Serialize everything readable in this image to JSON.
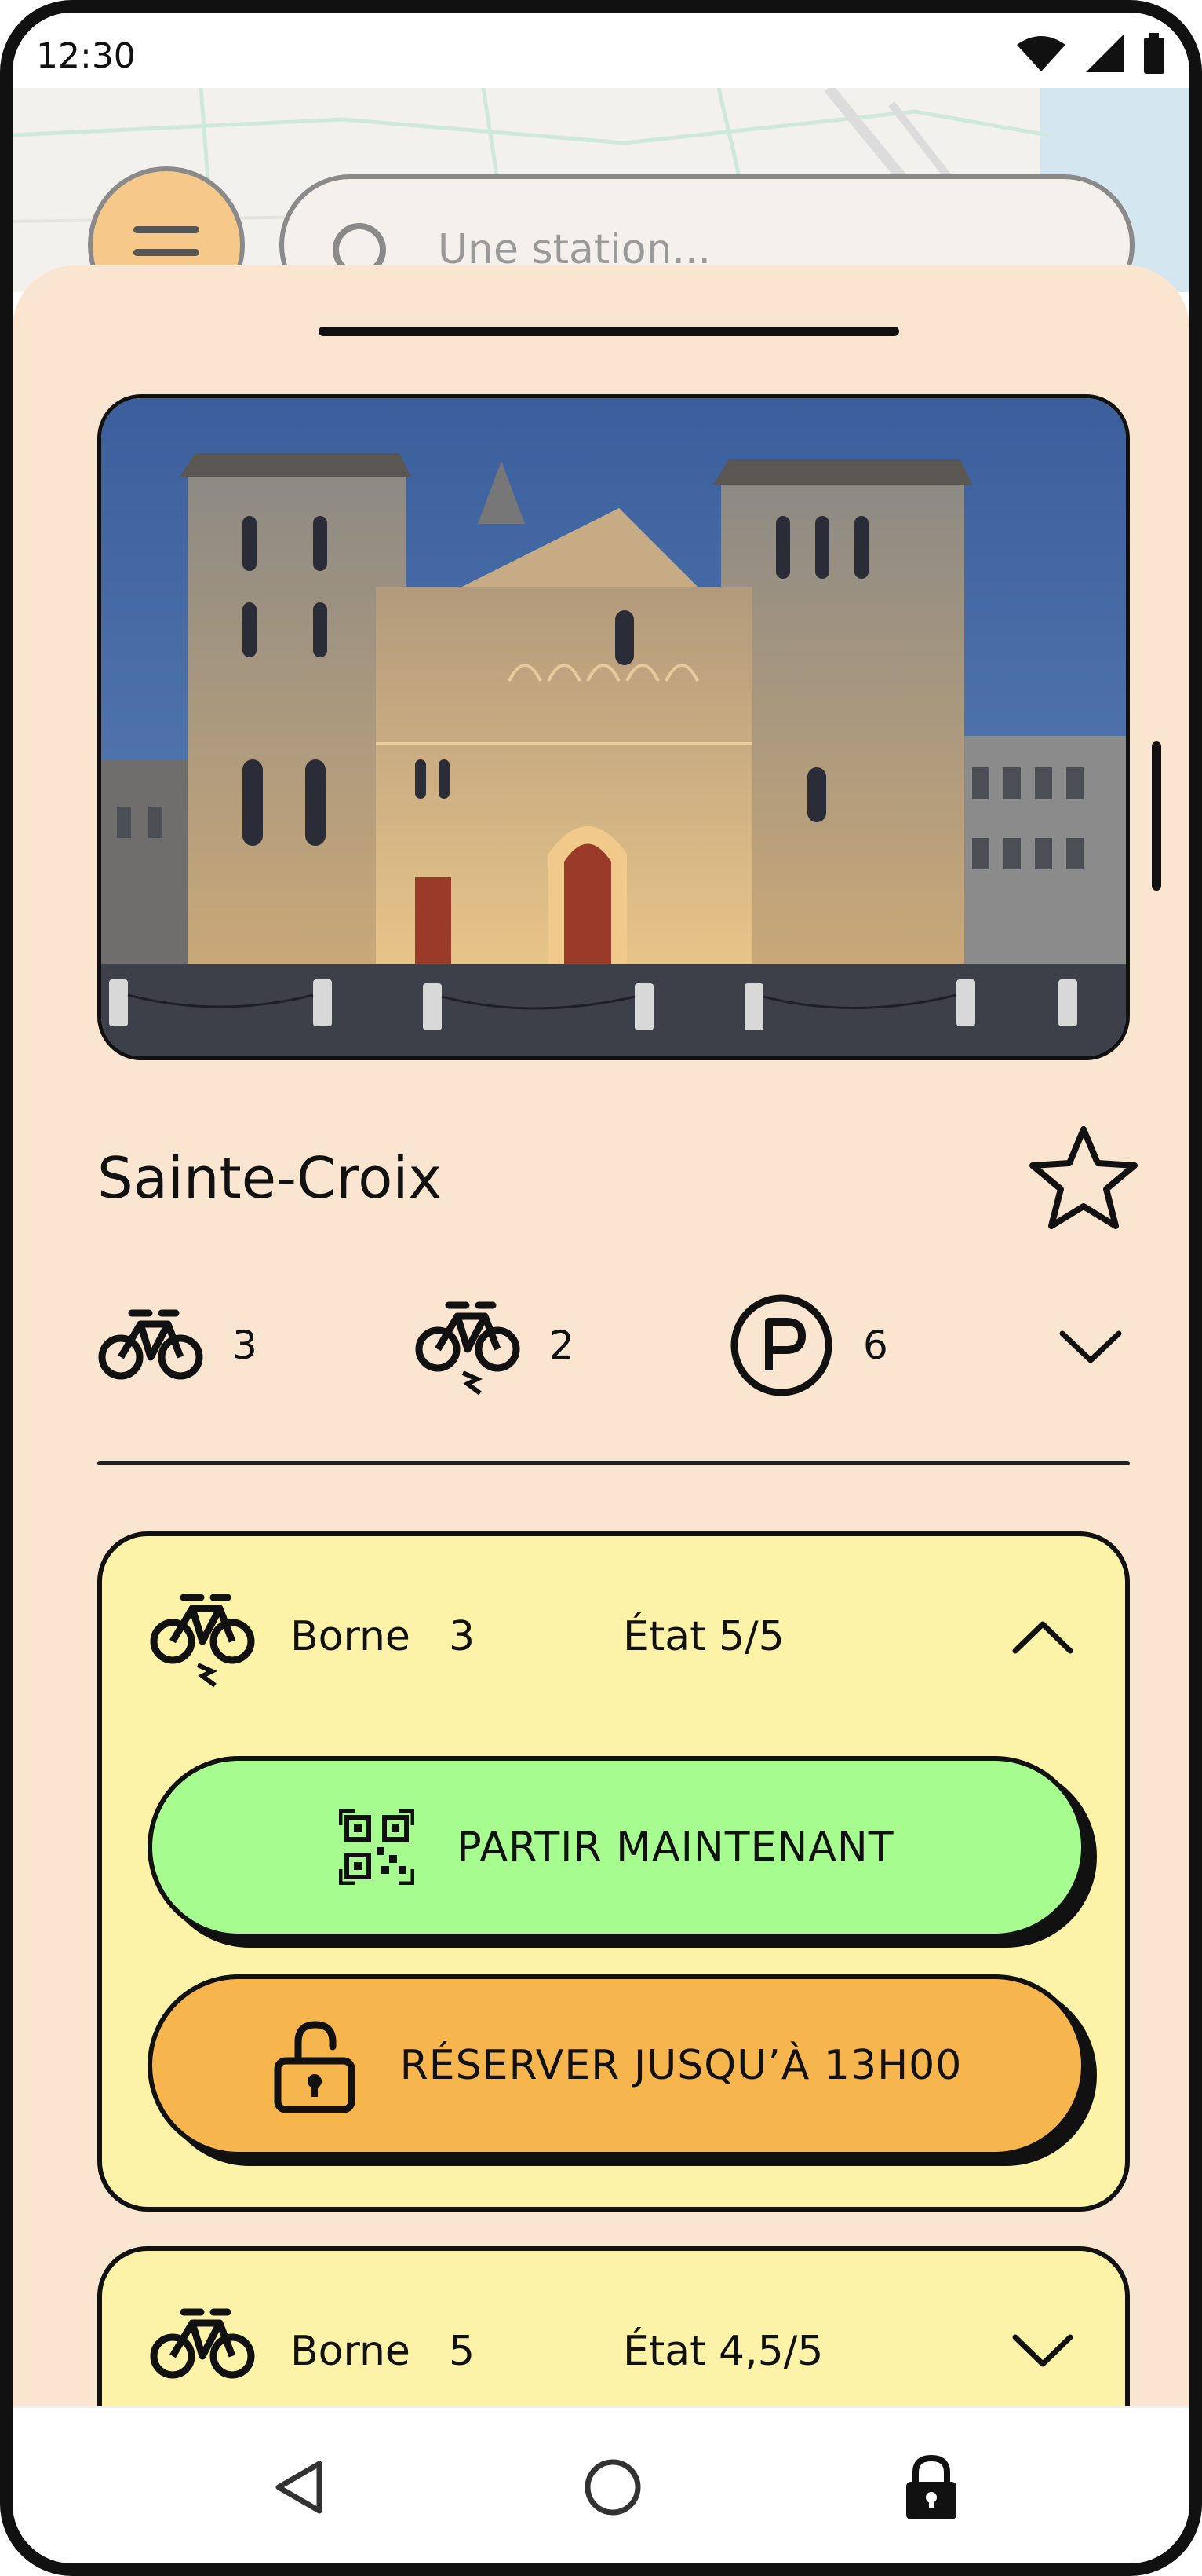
{
  "status_bar": {
    "time": "12:30"
  },
  "search": {
    "placeholder": "Une station..."
  },
  "station": {
    "name": "Sainte-Croix",
    "stats": {
      "bikes": "3",
      "ebikes": "2",
      "parking": "6"
    }
  },
  "docks": [
    {
      "label": "Borne",
      "number": "3",
      "state": "État 5/5",
      "expanded": true
    },
    {
      "label": "Borne",
      "number": "5",
      "state": "État 4,5/5",
      "expanded": false
    }
  ],
  "actions": {
    "go_label": "PARTIR MAINTENANT",
    "reserve_label": "RÉSERVER JUSQU’À 13H00"
  },
  "icons": {
    "menu": "menu-icon",
    "search": "search-icon",
    "favorite": "star-icon",
    "bike": "bike-icon",
    "ebike": "ebike-icon",
    "parking": "parking-icon",
    "qr": "qr-code-icon",
    "lock": "unlock-icon"
  },
  "colors": {
    "sheet": "#fae5d0",
    "card": "#fdf3a8",
    "go": "#a6fc8e",
    "reserve": "#f7b54e",
    "menu_button": "#f6c98a"
  }
}
